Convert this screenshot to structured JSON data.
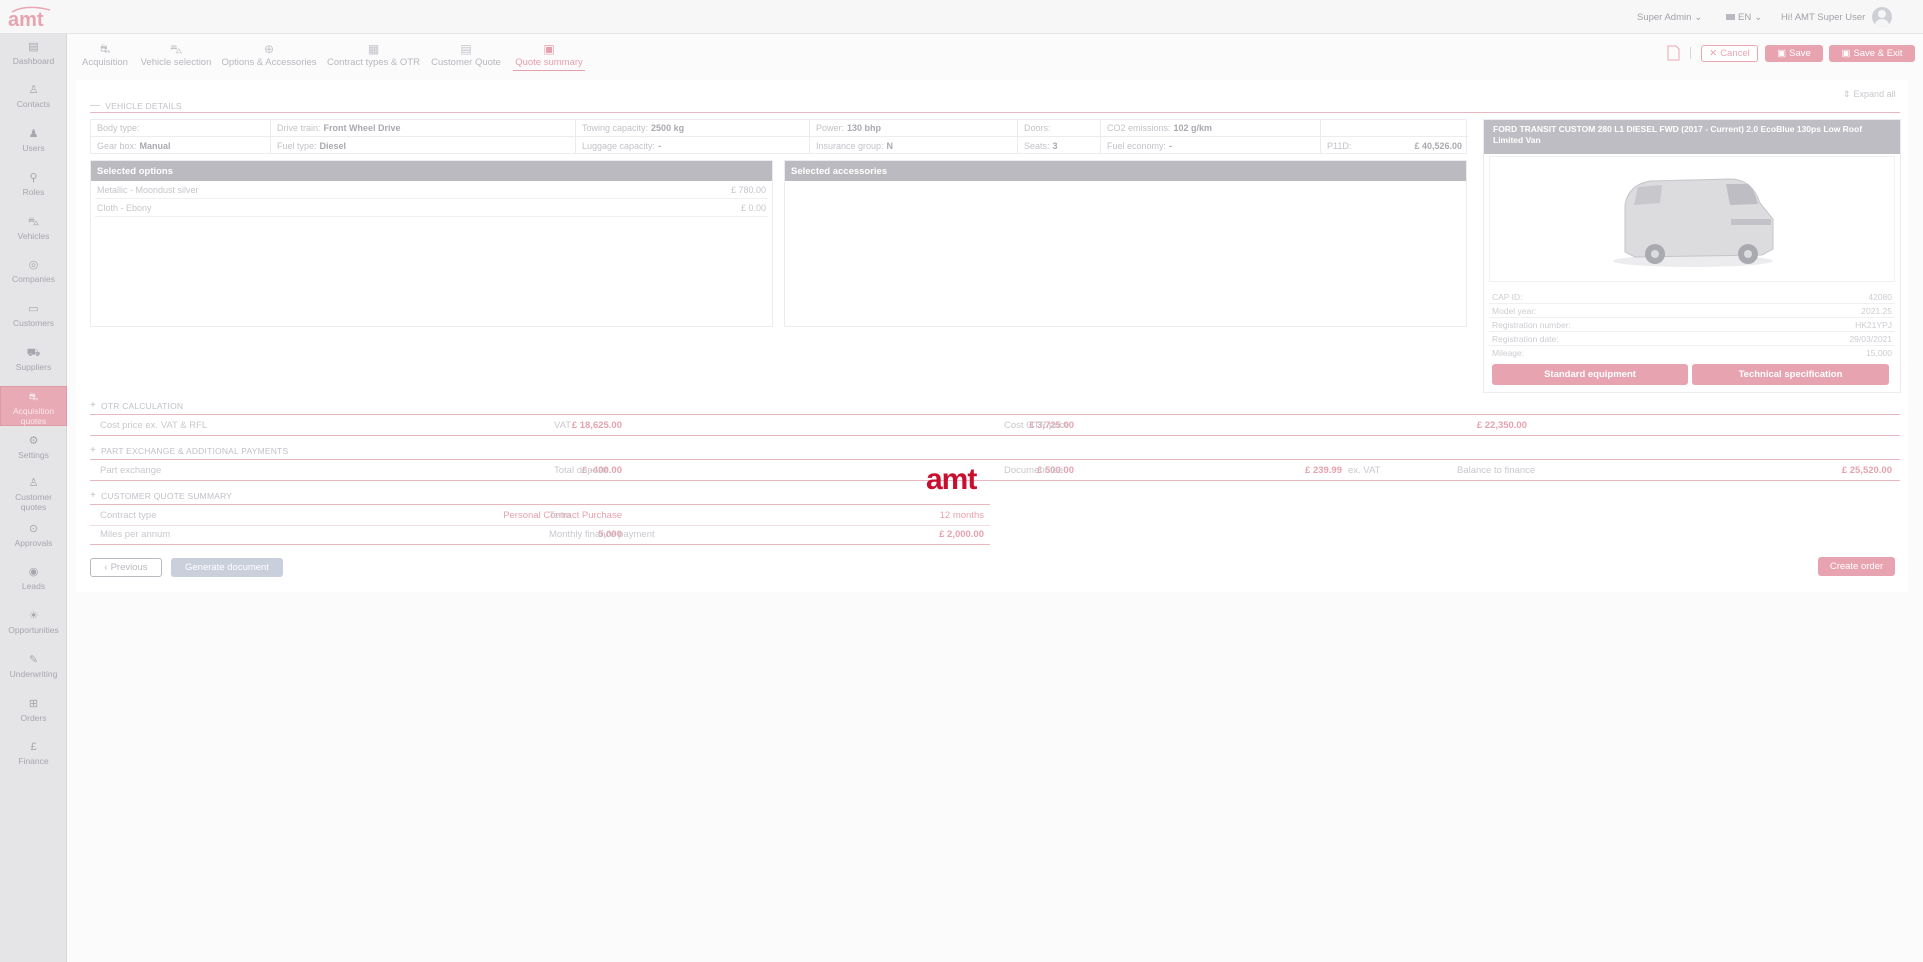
{
  "app": {
    "logo_text": "amt",
    "watermark": "amt"
  },
  "topbar": {
    "role": "Super Admin",
    "language": "EN",
    "greeting": "Hi! AMT Super User"
  },
  "sidebar": {
    "items": [
      {
        "label": "Dashboard",
        "icon": "dashboard-icon"
      },
      {
        "label": "Contacts",
        "icon": "contacts-icon"
      },
      {
        "label": "Users",
        "icon": "user-icon"
      },
      {
        "label": "Roles",
        "icon": "roles-icon"
      },
      {
        "label": "Vehicles",
        "icon": "car-icon"
      },
      {
        "label": "Companies",
        "icon": "companies-icon"
      },
      {
        "label": "Customers",
        "icon": "customers-icon"
      },
      {
        "label": "Suppliers",
        "icon": "truck-icon"
      },
      {
        "label": "Acquisition quotes",
        "icon": "acquisition-icon"
      },
      {
        "label": "Settings",
        "icon": "gear-icon"
      },
      {
        "label": "Customer quotes",
        "icon": "customer-quotes-icon"
      },
      {
        "label": "Approvals",
        "icon": "check-circle-icon"
      },
      {
        "label": "Leads",
        "icon": "leads-icon"
      },
      {
        "label": "Opportunities",
        "icon": "lightbulb-icon"
      },
      {
        "label": "Underwriting",
        "icon": "underwriting-icon"
      },
      {
        "label": "Orders",
        "icon": "cart-icon"
      },
      {
        "label": "Finance",
        "icon": "pound-icon"
      }
    ]
  },
  "steps": [
    {
      "label": "Acquisition"
    },
    {
      "label": "Vehicle selection"
    },
    {
      "label": "Options & Accessories"
    },
    {
      "label": "Contract types & OTR"
    },
    {
      "label": "Customer Quote"
    },
    {
      "label": "Quote summary"
    }
  ],
  "actions": {
    "cancel": "Cancel",
    "save": "Save",
    "save_exit": "Save & Exit",
    "expand_all": "Expand all"
  },
  "vehicle_details": {
    "title": "VEHICLE DETAILS",
    "row1": [
      {
        "label": "Body type:",
        "value": ""
      },
      {
        "label": "Drive train:",
        "value": "Front Wheel Drive"
      },
      {
        "label": "Towing capacity:",
        "value": "2500 kg"
      },
      {
        "label": "Power:",
        "value": "130 bhp"
      },
      {
        "label": "Doors:",
        "value": ""
      },
      {
        "label": "CO2 emissions:",
        "value": "102 g/km"
      },
      {
        "label": "",
        "value": ""
      }
    ],
    "row2": [
      {
        "label": "Gear box:",
        "value": "Manual"
      },
      {
        "label": "Fuel type:",
        "value": "Diesel"
      },
      {
        "label": "Luggage capacity:",
        "value": "-"
      },
      {
        "label": "Insurance group:",
        "value": "N"
      },
      {
        "label": "Seats:",
        "value": "3"
      },
      {
        "label": "Fuel economy:",
        "value": "-"
      },
      {
        "label": "P11D:",
        "value": "£ 40,526.00"
      }
    ]
  },
  "selected_options": {
    "title": "Selected options",
    "items": [
      {
        "name": "Metallic - Moondust silver",
        "price": "£ 780.00"
      },
      {
        "name": "Cloth - Ebony",
        "price": "£ 0.00"
      }
    ]
  },
  "selected_accessories": {
    "title": "Selected accessories",
    "items": []
  },
  "vehicle_card": {
    "title": "FORD TRANSIT CUSTOM 280 L1 DIESEL FWD (2017 - Current) 2.0 EcoBlue 130ps Low Roof Limited Van",
    "rows": [
      {
        "label": "CAP ID:",
        "value": "42080"
      },
      {
        "label": "Model year:",
        "value": "2021.25"
      },
      {
        "label": "Registration number:",
        "value": "HK21YPJ"
      },
      {
        "label": "Registration date:",
        "value": "29/03/2021"
      },
      {
        "label": "Mileage:",
        "value": "15,000"
      }
    ],
    "btn_standard": "Standard equipment",
    "btn_technical": "Technical specification"
  },
  "otr": {
    "title": "OTR CALCULATION",
    "cost_label": "Cost price ex. VAT & RFL",
    "cost_value": "£ 18,625.00",
    "vat_label": "VAT",
    "vat_value": "£ 3,725.00",
    "otr_label": "Cost OTR price",
    "otr_value": "£ 22,350.00"
  },
  "part_exchange": {
    "title": "PART EXCHANGE & ADDITIONAL PAYMENTS",
    "px_label": "Part exchange",
    "px_value": "£ -400.00",
    "deposit_label": "Total deposit",
    "deposit_value": "£ 500.00",
    "fee_label": "Document fee",
    "fee_value": "£ 239.99",
    "fee_suffix": "ex. VAT",
    "balance_label": "Balance to finance",
    "balance_value": "£ 25,520.00"
  },
  "customer_quote": {
    "title": "CUSTOMER QUOTE SUMMARY",
    "contract_label": "Contract type",
    "contract_value": "Personal Contract Purchase",
    "term_label": "Term",
    "term_value": "12 months",
    "miles_label": "Miles per annum",
    "miles_value": "5,000",
    "monthly_label": "Monthly finance payment",
    "monthly_value": "£ 2,000.00"
  },
  "footer": {
    "previous": "Previous",
    "generate": "Generate document",
    "create_order": "Create order"
  },
  "colors": {
    "accent": "#e7a4b0",
    "header_grey": "#babac0",
    "sidebar_bg": "#e5e5e8"
  }
}
